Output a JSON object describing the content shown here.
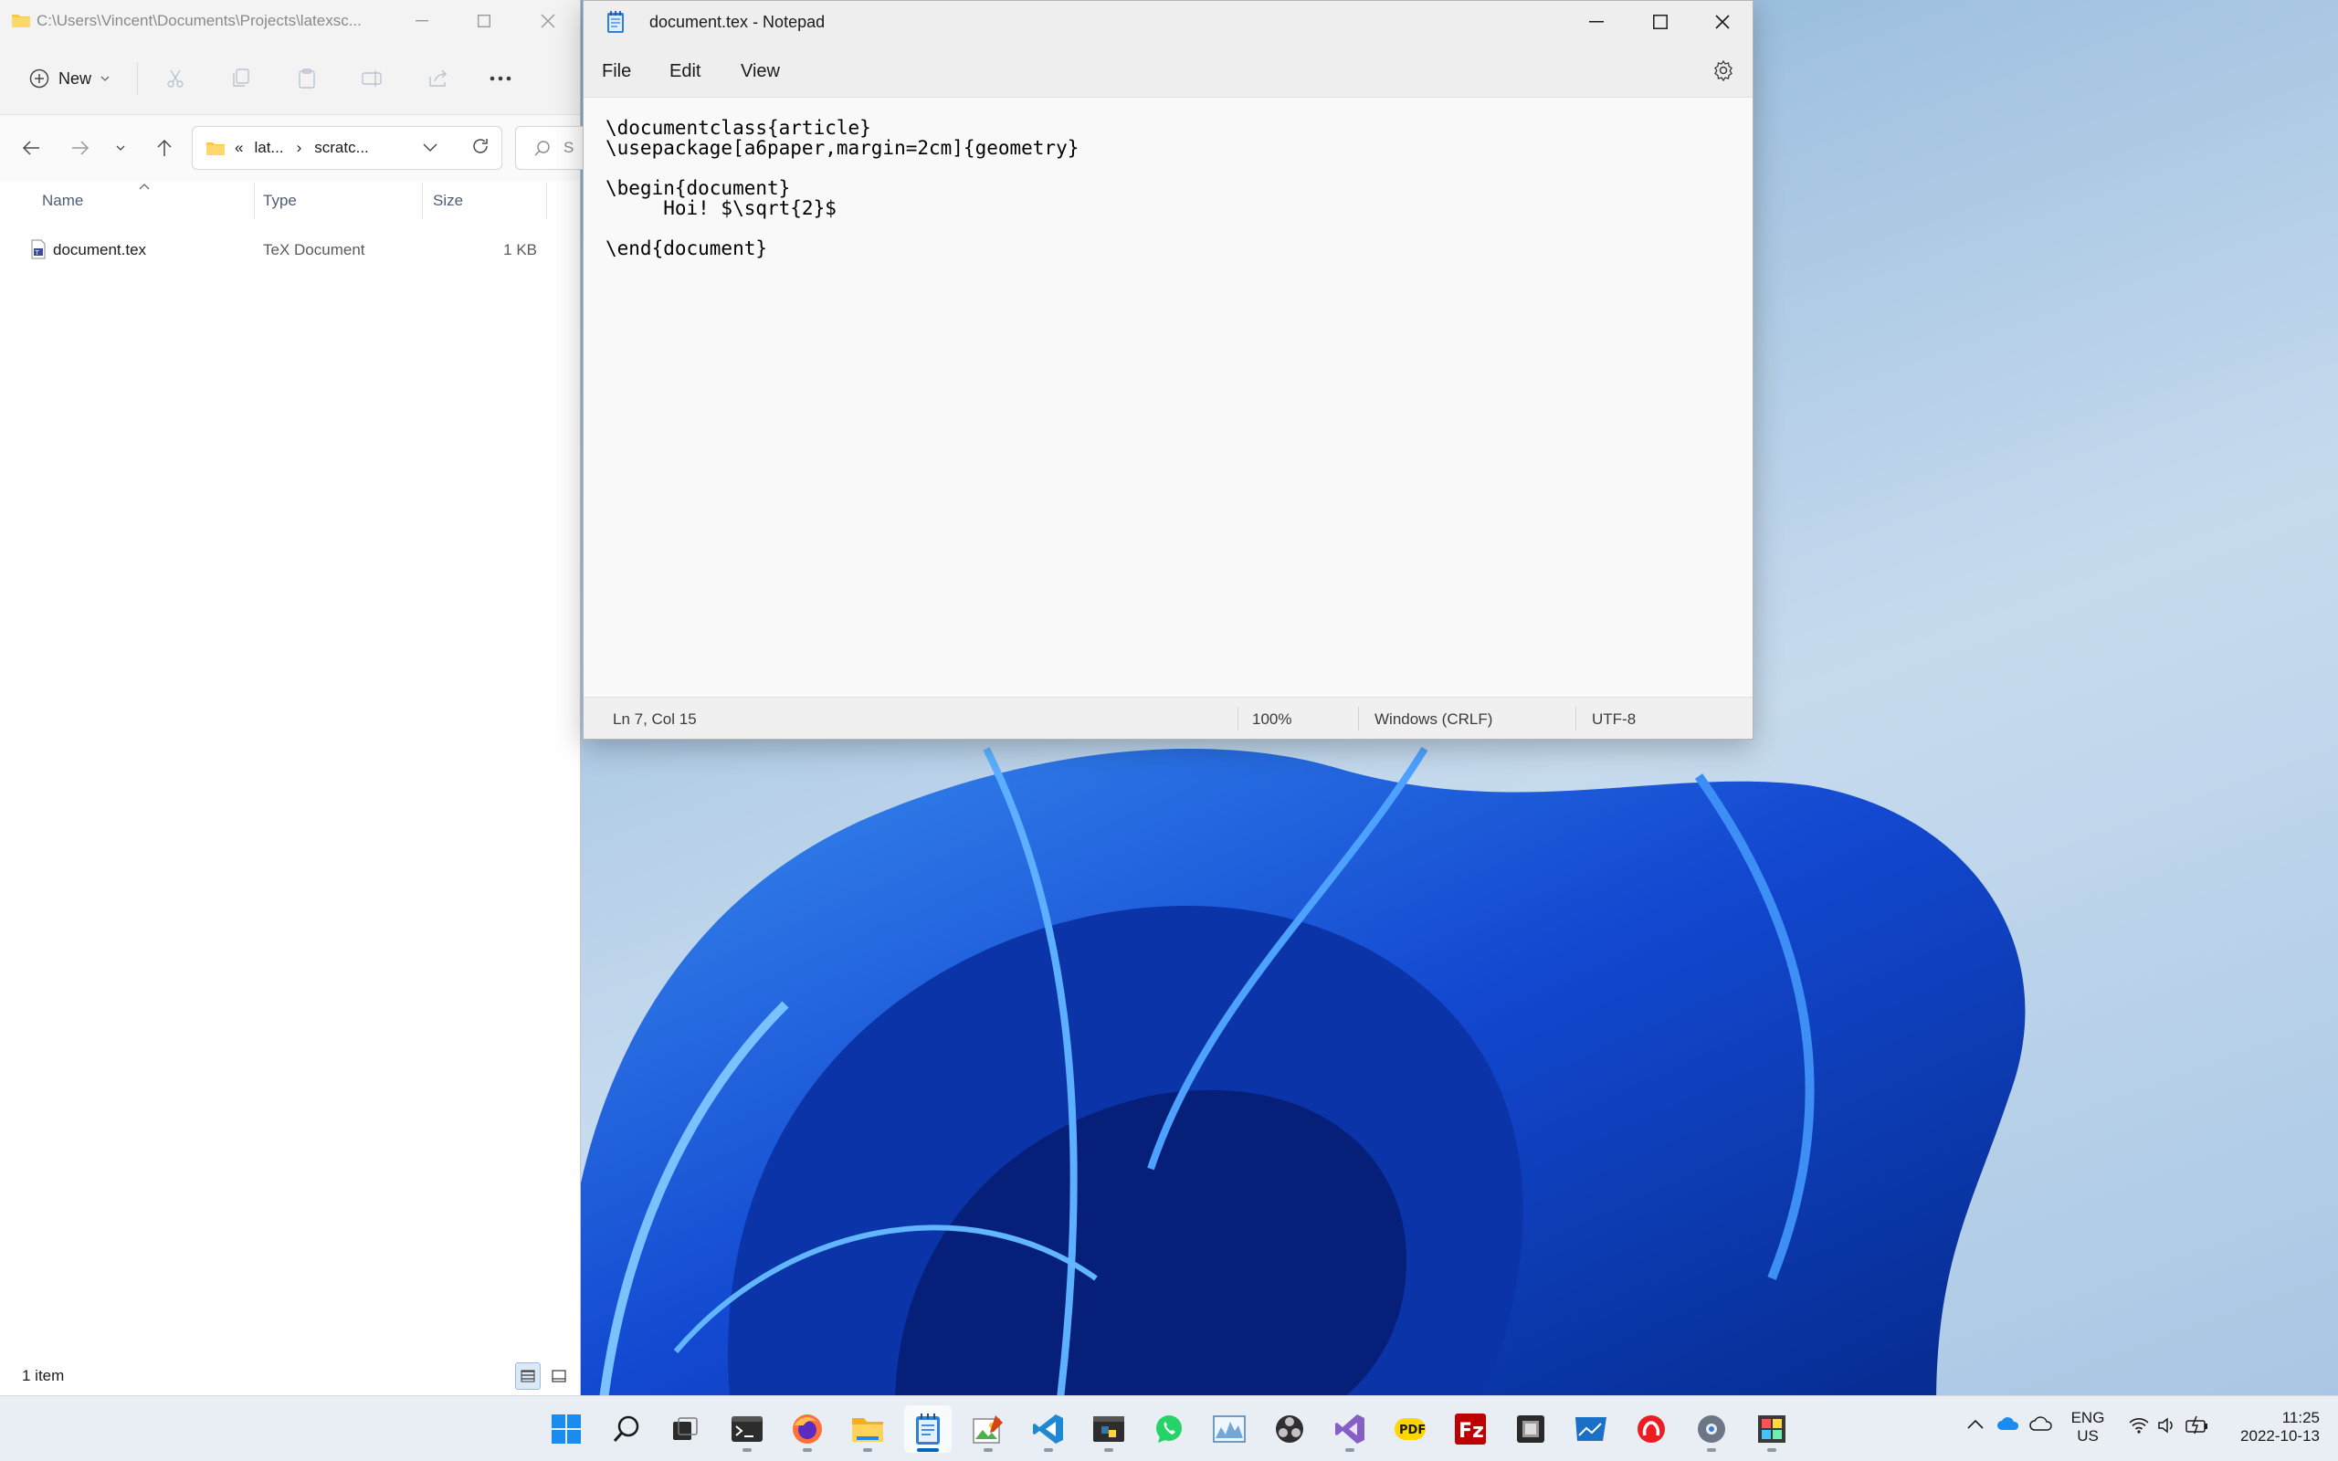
{
  "explorer": {
    "title": "C:\\Users\\Vincent\\Documents\\Projects\\latexsc...",
    "new_label": "New",
    "breadcrumb": {
      "chevrons": "«",
      "part1": "lat...",
      "separator": "›",
      "part2": "scratc..."
    },
    "search_placeholder": "S",
    "columns": {
      "name": "Name",
      "type": "Type",
      "size": "Size"
    },
    "files": [
      {
        "name": "document.tex",
        "type": "TeX Document",
        "size": "1 KB"
      }
    ],
    "status": "1 item"
  },
  "notepad": {
    "title": "document.tex - Notepad",
    "menu": [
      "File",
      "Edit",
      "View"
    ],
    "content": "\\documentclass{article}\n\\usepackage[a6paper,margin=2cm]{geometry}\n\n\\begin{document}\n     Hoi! $\\sqrt{2}$\n\n\\end{document}",
    "status": {
      "position": "Ln 7, Col 15",
      "zoom": "100%",
      "line_ending": "Windows (CRLF)",
      "encoding": "UTF-8"
    }
  },
  "taskbar": {
    "apps": [
      "start-icon",
      "search-icon",
      "task-view-icon",
      "terminal-icon",
      "firefox-icon",
      "file-explorer-icon",
      "notepad-icon",
      "image-editor-icon",
      "vscode-icon",
      "python-icon",
      "whatsapp-icon",
      "resource-monitor-icon",
      "obs-icon",
      "visual-studio-icon",
      "pdf-icon",
      "filezilla-icon",
      "vm-icon",
      "chart-app-icon",
      "authy-icon",
      "settings-icon",
      "paint-icon"
    ],
    "language": {
      "line1": "ENG",
      "line2": "US"
    },
    "clock": {
      "time": "11:25",
      "date": "2022-10-13"
    }
  },
  "colors": {
    "accent": "#0067c0",
    "wallpaper_blue": "#1450d8"
  }
}
